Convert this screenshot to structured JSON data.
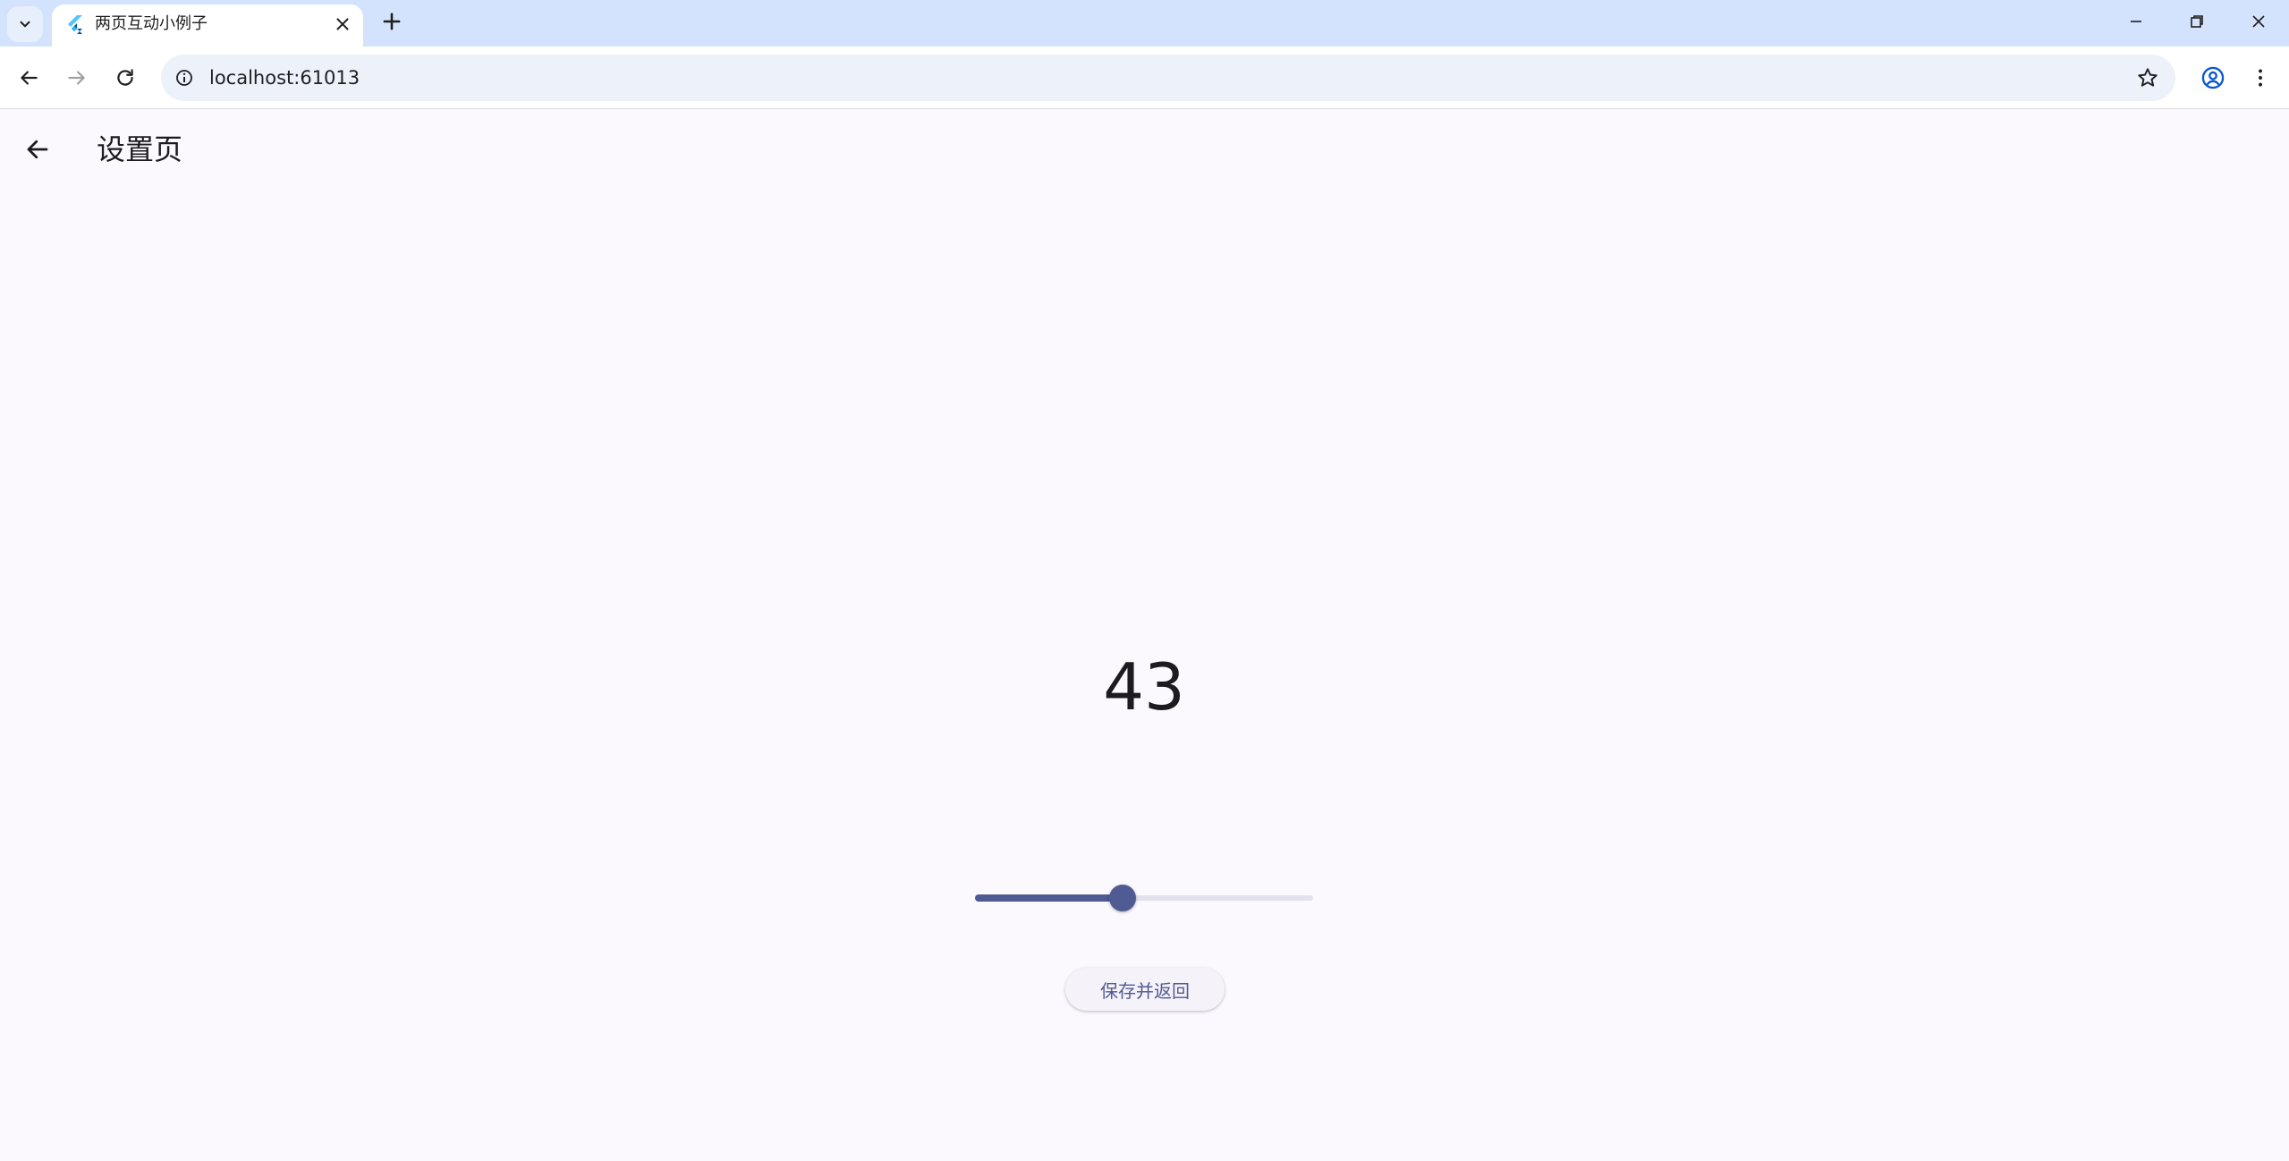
{
  "browser": {
    "tab": {
      "title": "两页互动小例子",
      "favicon": "flutter-icon"
    },
    "url": "localhost:61013"
  },
  "app": {
    "title": "设置页",
    "value": "43",
    "slider": {
      "value": 43,
      "min": 0,
      "max": 100
    },
    "save_button_label": "保存并返回"
  },
  "colors": {
    "primary": "#4f5b92",
    "background": "#fbf8fe",
    "tabstrip": "#d3e3fd"
  }
}
